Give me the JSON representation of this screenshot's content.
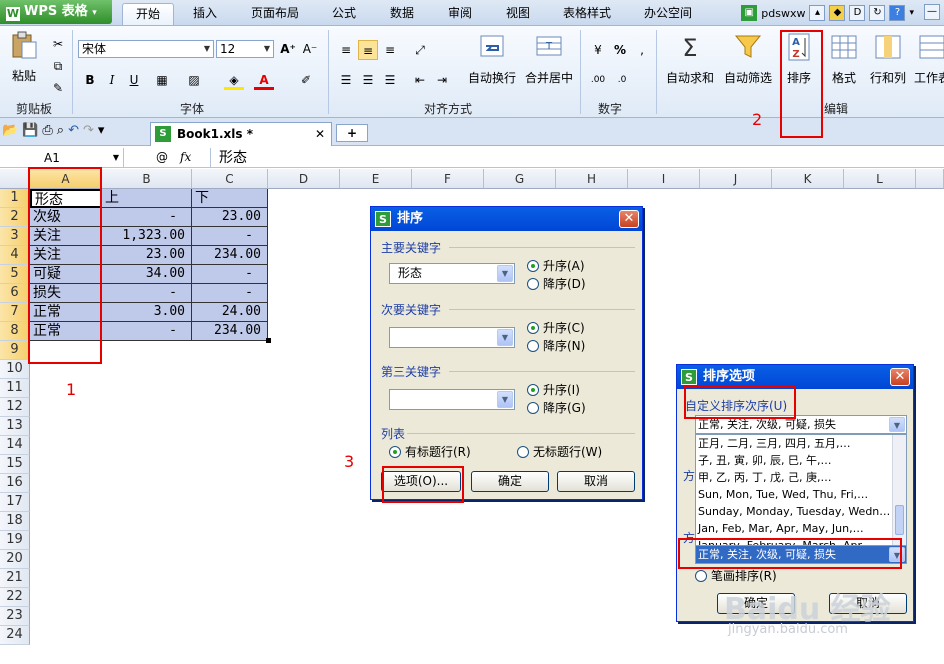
{
  "app": {
    "name": "WPS 表格",
    "logo": "W"
  },
  "menu_tabs": [
    "开始",
    "插入",
    "页面布局",
    "公式",
    "数据",
    "审阅",
    "视图",
    "表格样式",
    "办公空间"
  ],
  "active_tab": "开始",
  "user": "pdswxw",
  "ribbon": {
    "clipboard": {
      "paste": "粘贴",
      "label": "剪贴板"
    },
    "font": {
      "name": "宋体",
      "size": "12",
      "label": "字体",
      "bold": "B",
      "italic": "I",
      "underline": "U",
      "grow": "A⁺",
      "shrink": "A⁻",
      "font_color_glyph": "A"
    },
    "align": {
      "wrap": "自动换行",
      "merge": "合并居中",
      "label": "对齐方式"
    },
    "number": {
      "percent": "%",
      "label": "数字"
    },
    "edit": {
      "autosum": "自动求和",
      "autofilter": "自动筛选",
      "sort": "排序",
      "format": "格式",
      "rowcol": "行和列",
      "sheet": "工作表",
      "label": "编辑"
    }
  },
  "doc_tab": {
    "name": "Book1.xls *",
    "add": "+"
  },
  "formula_bar": {
    "cell": "A1",
    "fx": "fx",
    "at": "@",
    "content": "形态"
  },
  "columns": [
    "A",
    "B",
    "C",
    "D",
    "E",
    "F",
    "G",
    "H",
    "I",
    "J",
    "K",
    "L"
  ],
  "rows": [
    "1",
    "2",
    "3",
    "4",
    "5",
    "6",
    "7",
    "8",
    "9",
    "10",
    "11",
    "12",
    "13",
    "14",
    "15",
    "16",
    "17",
    "18",
    "19",
    "20",
    "21",
    "22",
    "23",
    "24"
  ],
  "table": [
    [
      "形态",
      "上",
      "下"
    ],
    [
      "次级",
      "-",
      "23.00"
    ],
    [
      "关注",
      "1,323.00",
      "-"
    ],
    [
      "关注",
      "23.00",
      "234.00"
    ],
    [
      "可疑",
      "34.00",
      "-"
    ],
    [
      "损失",
      "-",
      "-"
    ],
    [
      "正常",
      "3.00",
      "24.00"
    ],
    [
      "正常",
      "-",
      "234.00"
    ]
  ],
  "sort_dialog": {
    "title": "排序",
    "key1_label": "主要关键字",
    "key1_value": "形态",
    "key2_label": "次要关键字",
    "key2_value": "",
    "key3_label": "第三关键字",
    "key3_value": "",
    "asc1": "升序(A)",
    "desc1": "降序(D)",
    "asc2": "升序(C)",
    "desc2": "降序(N)",
    "asc3": "升序(I)",
    "desc3": "降序(G)",
    "list_label": "列表",
    "has_header": "有标题行(R)",
    "no_header": "无标题行(W)",
    "options_btn": "选项(O)...",
    "ok_btn": "确定",
    "cancel_btn": "取消"
  },
  "options_dialog": {
    "title": "排序选项",
    "custom_label": "自定义排序次序(U)",
    "top_value": "正常, 关注, 次级, 可疑, 损失",
    "list_items": [
      "正月, 二月, 三月, 四月, 五月,…",
      "子, 丑, 寅, 卯, 辰, 巳, 午,…",
      "甲, 乙, 丙, 丁, 戊, 己, 庚,…",
      "Sun, Mon, Tue, Wed, Thu, Fri,…",
      "Sunday, Monday, Tuesday, Wedn…",
      "Jan, Feb, Mar, Apr, May, Jun,…",
      "January, February, March, Apr…"
    ],
    "selected_value": "正常, 关注, 次级, 可疑, 损失",
    "stroke_sort": "笔画排序(R)",
    "dir_hint_1": "方",
    "dir_hint_2": "方",
    "ok_btn": "确定",
    "cancel_btn": "取消"
  },
  "annotations": [
    "1",
    "2",
    "3",
    "4"
  ],
  "watermark": {
    "brand": "Baidu 经验",
    "url": "jingyan.baidu.com"
  },
  "colors": {
    "selection": "#bfc9ea",
    "annotation": "#e60000",
    "title_blue": "#0046d5"
  }
}
